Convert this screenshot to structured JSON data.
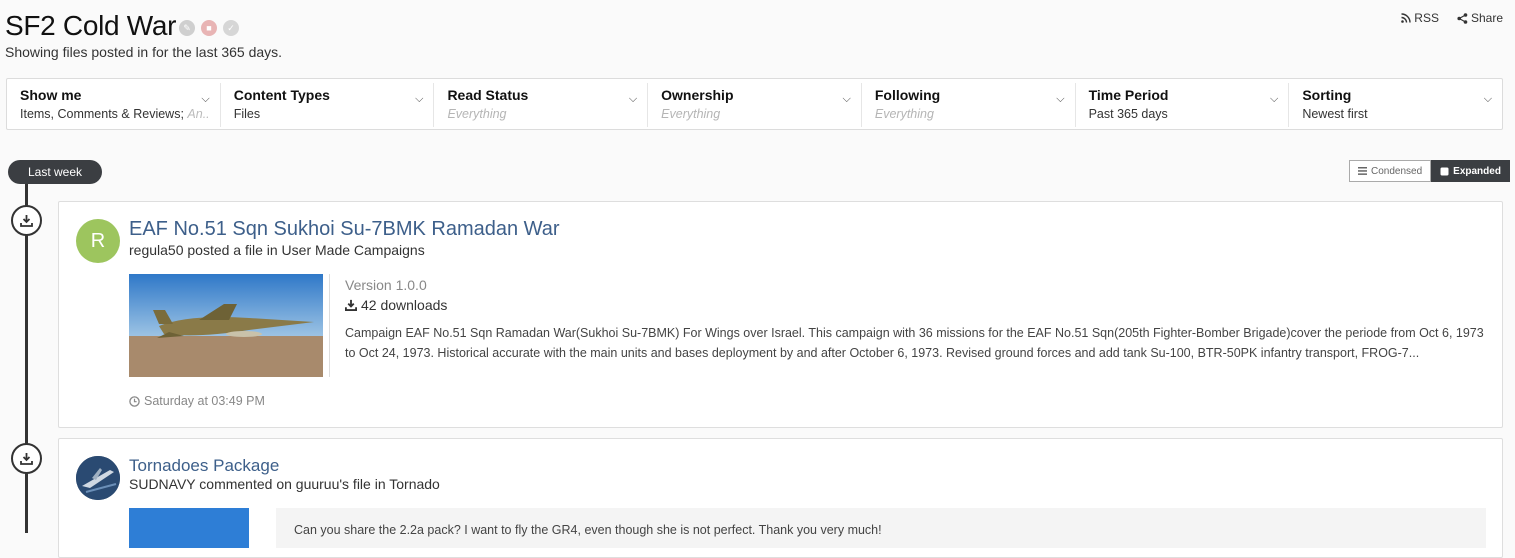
{
  "page": {
    "title": "SF2 Cold War",
    "subtitle": "Showing files posted in for the last 365 days."
  },
  "actions": {
    "rss": "RSS",
    "share": "Share"
  },
  "filters": [
    {
      "label": "Show me",
      "value": "Items, Comments & Reviews;",
      "extra": "An..."
    },
    {
      "label": "Content Types",
      "value": "Files"
    },
    {
      "label": "Read Status",
      "value": "Everything",
      "muted": true
    },
    {
      "label": "Ownership",
      "value": "Everything",
      "muted": true
    },
    {
      "label": "Following",
      "value": "Everything",
      "muted": true
    },
    {
      "label": "Time Period",
      "value": "Past 365 days"
    },
    {
      "label": "Sorting",
      "value": "Newest first"
    }
  ],
  "timeline": {
    "label": "Last week"
  },
  "view_toggle": {
    "condensed": "Condensed",
    "expanded": "Expanded",
    "active": "expanded"
  },
  "items": [
    {
      "avatar_letter": "R",
      "avatar_color": "#9dc55e",
      "title": "EAF No.51 Sqn Sukhoi Su-7BMK Ramadan War",
      "meta": "regula50 posted a file in User Made Campaigns",
      "version": "Version 1.0.0",
      "downloads": "42 downloads",
      "description": "Campaign EAF No.51 Sqn Ramadan War(Sukhoi Su-7BMK) For Wings over Israel. This campaign with 36 missions for the EAF No.51 Sqn(205th Fighter-Bomber Brigade)cover the periode from Oct 6, 1973 to Oct 24, 1973. Historical accurate with the main units and bases deployment by and after October 6, 1973. Revised ground forces and add tank Su-100, BTR-50PK infantry transport, FROG-7...",
      "time": "Saturday at 03:49 PM"
    },
    {
      "title": "Tornadoes Package",
      "meta": "SUDNAVY commented on guuruu's file in Tornado",
      "quote": "Can you share the 2.2a pack? I want to fly the GR4, even though she is not perfect. Thank you very much!"
    }
  ],
  "colors": {
    "link": "#3d5f8a",
    "dark": "#3b3e42",
    "accent_avatar": "#9dc55e"
  }
}
